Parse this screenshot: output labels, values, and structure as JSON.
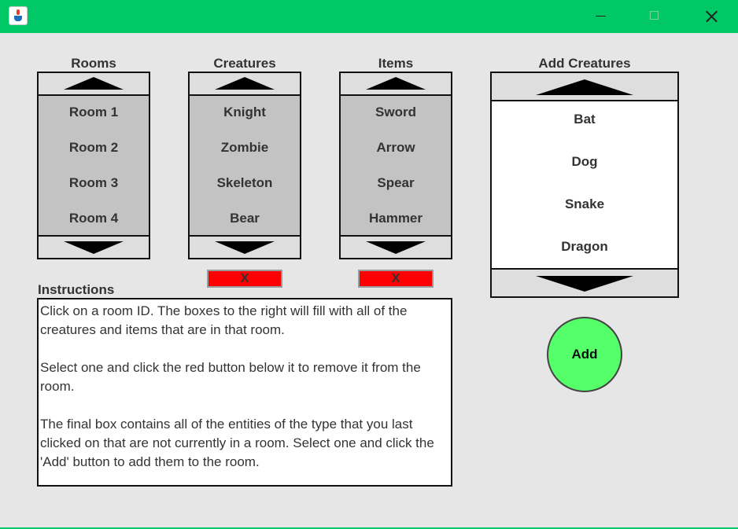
{
  "window": {
    "icon": "java-cup-icon",
    "controls": [
      "minimize-icon",
      "maximize-icon",
      "close-icon"
    ],
    "titlebar_color": "#00c866"
  },
  "rooms": {
    "heading": "Rooms",
    "items": [
      "Room 1",
      "Room 2",
      "Room 3",
      "Room 4"
    ]
  },
  "creatures": {
    "heading": "Creatures",
    "items": [
      "Knight",
      "Zombie",
      "Skeleton",
      "Bear"
    ],
    "remove_label": "X"
  },
  "items_list": {
    "heading": "Items",
    "items": [
      "Sword",
      "Arrow",
      "Spear",
      "Hammer"
    ],
    "remove_label": "X"
  },
  "add_creatures": {
    "heading": "Add Creatures",
    "items": [
      "Bat",
      "Dog",
      "Snake",
      "Dragon"
    ]
  },
  "instructions": {
    "title": "Instructions",
    "paragraphs": [
      "Click on a room ID. The boxes to the right will fill with all of the creatures and items that are in that room.",
      "Select one and click the red button below it to remove it from the room.",
      "The final box contains all of the entities of the type that you last clicked on that are not currently in a room. Select one and click the 'Add' button to add them to the room."
    ]
  },
  "add_button": {
    "label": "Add",
    "color": "#55ff6a"
  },
  "colors": {
    "remove": "#ff0000",
    "list_bg": "#c3c3c3",
    "add_list_bg": "#ffffff"
  }
}
